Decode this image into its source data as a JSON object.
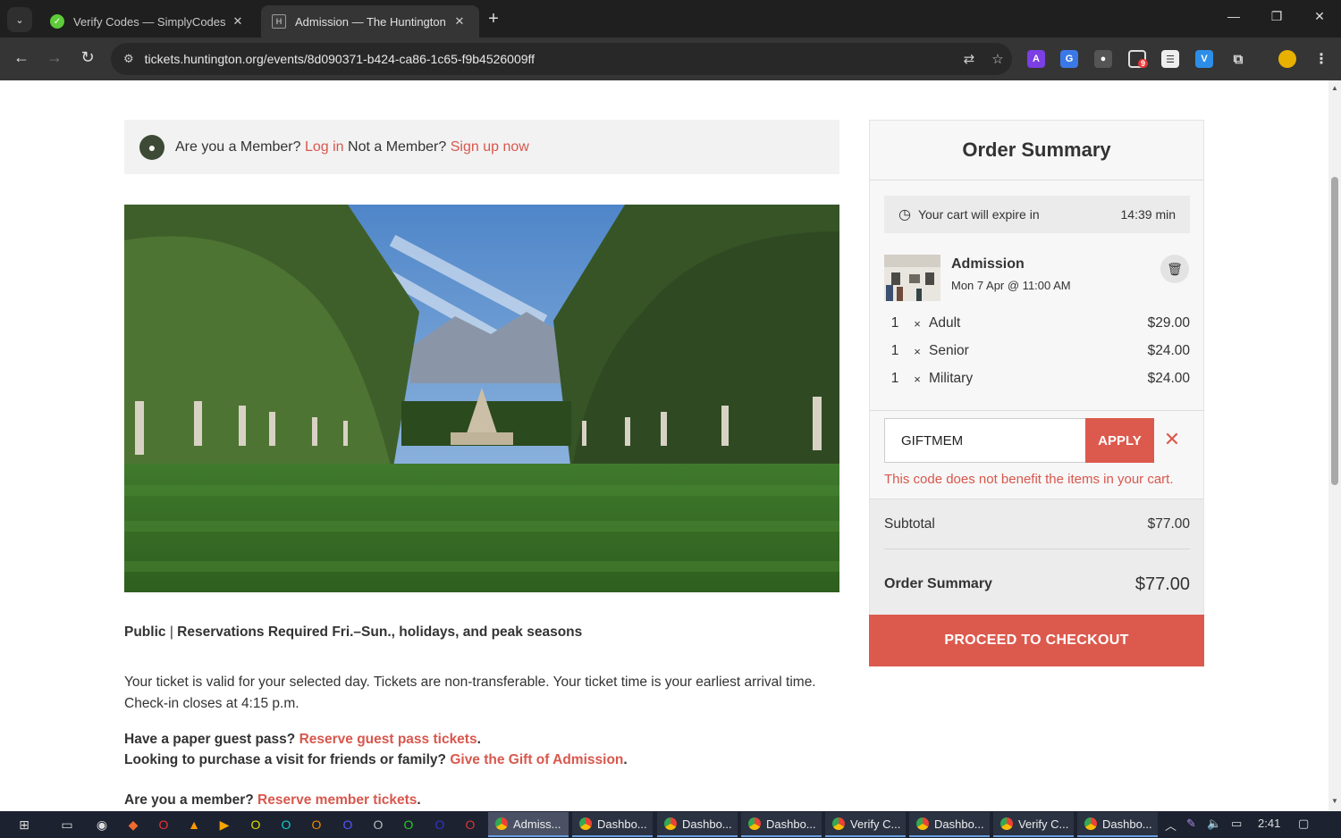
{
  "browser": {
    "tabs": [
      {
        "title": "Verify Codes — SimplyCodes",
        "active": false
      },
      {
        "title": "Admission — The Huntington",
        "active": true
      }
    ],
    "url": "tickets.huntington.org/events/8d090371-b424-ca86-1c65-f9b4526009ff",
    "extension_badge": "9"
  },
  "member_bar": {
    "question": "Are you a Member?",
    "login": "Log in",
    "not_member": "Not a Member?",
    "signup": "Sign up now"
  },
  "description": {
    "heading_public": "Public",
    "heading_sep": "|",
    "heading_rest": "Reservations Required Fri.–Sun., holidays, and peak seasons",
    "validity": "Your ticket is valid for your selected day. Tickets are non-transferable. Your ticket time is your earliest arrival time. Check-in closes at 4:15 p.m.",
    "guest_q": "Have a paper guest pass?",
    "guest_link": "Reserve guest pass tickets",
    "gift_q": "Looking to purchase a visit for friends or family?",
    "gift_link": "Give the Gift of Admission",
    "member_q": "Are you a member?",
    "member_link": "Reserve member tickets"
  },
  "order": {
    "title": "Order Summary",
    "expire_label": "Your cart will expire in",
    "expire_time": "14:39 min",
    "item_name": "Admission",
    "item_date": "Mon 7 Apr @ 11:00 AM",
    "lines": [
      {
        "qty": "1",
        "x": "×",
        "name": "Adult",
        "price": "$29.00"
      },
      {
        "qty": "1",
        "x": "×",
        "name": "Senior",
        "price": "$24.00"
      },
      {
        "qty": "1",
        "x": "×",
        "name": "Military",
        "price": "$24.00"
      }
    ],
    "promo_value": "GIFTMEM",
    "apply_label": "APPLY",
    "promo_error": "This code does not benefit the items in your cart.",
    "subtotal_label": "Subtotal",
    "subtotal_value": "$77.00",
    "total_label": "Order Summary",
    "total_value": "$77.00",
    "checkout_label": "PROCEED TO CHECKOUT"
  },
  "taskbar": {
    "apps": [
      "Admiss...",
      "Dashbo...",
      "Dashbo...",
      "Dashbo...",
      "Verify C...",
      "Dashbo...",
      "Verify C...",
      "Dashbo..."
    ],
    "clock": "2:41"
  },
  "colors": {
    "accent": "#dc5a4d",
    "link": "#d8574d"
  }
}
